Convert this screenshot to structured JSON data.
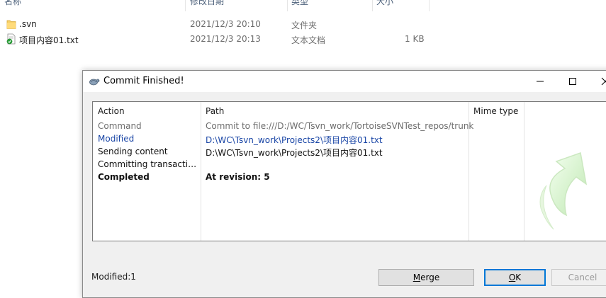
{
  "explorer": {
    "columns": {
      "name": "名称",
      "modified": "修改日期",
      "type": "类型",
      "size": "大小"
    },
    "files": [
      {
        "name": ".svn",
        "modified": "2021/12/3 20:10",
        "type": "文件夹",
        "size": "",
        "icon": "folder-icon"
      },
      {
        "name": "项目内容01.txt",
        "modified": "2021/12/3 20:13",
        "type": "文本文档",
        "size": "1 KB",
        "icon": "svn-normal-text-file-icon"
      }
    ]
  },
  "dialog": {
    "title": "Commit Finished!",
    "columns": {
      "action": "Action",
      "path": "Path",
      "mime": "Mime type"
    },
    "log": [
      {
        "action": "Command",
        "path": "Commit to file:///D:/WC/Tsvn_work/TortoiseSVNTest_repos/trunk",
        "style": "gray"
      },
      {
        "action": "Modified",
        "path": "D:\\WC\\Tsvn_work\\Projects2\\项目内容01.txt",
        "style": "blue"
      },
      {
        "action": "Sending content",
        "path": "D:\\WC\\Tsvn_work\\Projects2\\项目内容01.txt",
        "style": "black"
      },
      {
        "action": "Committing transaction...",
        "path": "",
        "style": "black"
      },
      {
        "action": "Completed",
        "path": "At revision: 5",
        "style": "bold"
      }
    ],
    "status": "Modified:1",
    "buttons": {
      "merge": {
        "accel": "M",
        "rest": "erge"
      },
      "ok": {
        "accel": "O",
        "rest": "K"
      },
      "cancel": "Cancel"
    }
  },
  "colors": {
    "accent": "#0078d7",
    "link_blue": "#1a46a6",
    "dim_gray": "#6d6d6d",
    "window_bg": "#f0f0f0"
  }
}
